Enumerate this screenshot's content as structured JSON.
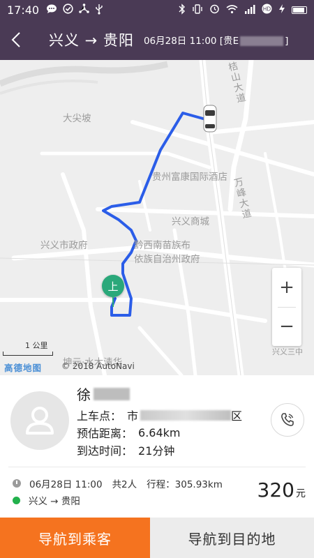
{
  "status_bar": {
    "time": "17:40",
    "left_icons": [
      "chat-icon",
      "check-circle-icon",
      "share-icon",
      "usb-icon"
    ],
    "right_icons": [
      "bluetooth-icon",
      "vibrate-icon",
      "alarm-icon",
      "wifi-icon",
      "signal-icon",
      "hd-icon",
      "charging-icon",
      "battery-icon"
    ]
  },
  "header": {
    "route": "兴义 → 贵阳",
    "subtitle_prefix": "06月28日 11:00 [贵E",
    "subtitle_suffix": "]"
  },
  "map": {
    "labels": {
      "dajianpo": "大尖坡",
      "guizhou_hotel": "贵州富康国际酒店",
      "xingyi_mall": "兴义商城",
      "xingyi_gov": "兴义市政府",
      "qxn_gov_line1": "黔西南苗族布",
      "qxn_gov_line2": "依族自治州政府",
      "jieshan_road": "桔山大道",
      "wanfeng_road": "万峰大道",
      "kunyuan": "坤元·水木清华",
      "school": "兴义三中"
    },
    "pickup_marker": "上",
    "zoom_in": "+",
    "zoom_out": "−",
    "scale": "1 公里",
    "logo": "高德地图",
    "copyright": "© 2018 AutoNavi",
    "route_color": "#2b5de8"
  },
  "passenger": {
    "name": "徐",
    "pickup_label": "上车点：",
    "pickup_value": "市",
    "pickup_suffix": "区",
    "distance_label": "预估距离：",
    "distance_value": "6.64km",
    "eta_label": "到达时间：",
    "eta_value": "21分钟"
  },
  "trip": {
    "datetime": "06月28日 11:00",
    "people": "共2人",
    "distance": "行程：305.93km",
    "route": "兴义 → 贵阳",
    "price": "320",
    "price_unit": "元"
  },
  "buttons": {
    "nav_passenger": "导航到乘客",
    "nav_destination": "导航到目的地"
  },
  "colors": {
    "header_bg": "#4a3a55",
    "accent_orange": "#f5731f",
    "pickup_green": "#2aa87a"
  }
}
